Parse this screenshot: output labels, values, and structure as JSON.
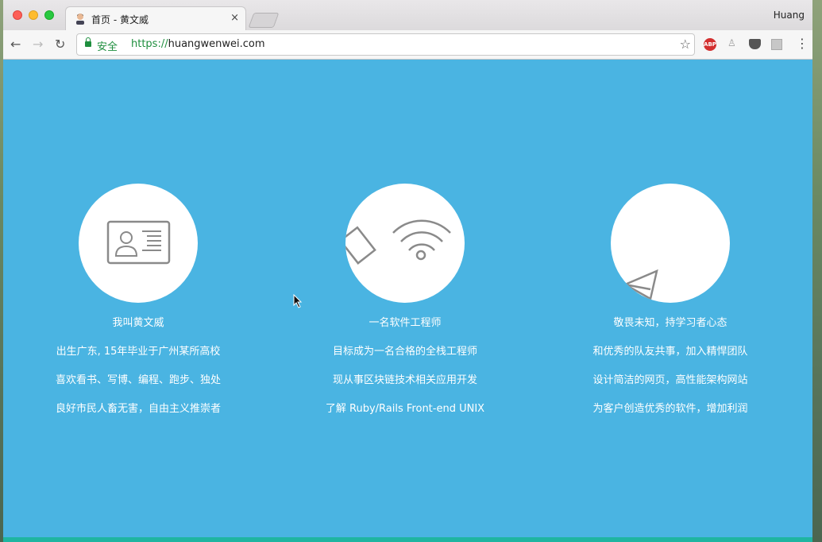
{
  "browser": {
    "tab_title": "首页 - 黄文威",
    "tab_close": "×",
    "profile_name": "Huang",
    "security_label": "安全",
    "url_scheme": "https://",
    "url_host": "huangwenwei.com",
    "extensions": [
      "ABP"
    ],
    "nav": {
      "back": "←",
      "forward": "→",
      "reload": "↻",
      "bookmark": "☆",
      "menu": "⋮"
    }
  },
  "features": [
    {
      "icon": "id-card-icon",
      "title": "我叫黄文威",
      "lines": [
        "出生广东, 15年毕业于广州某所高校",
        "喜欢看书、写博、编程、跑步、独处",
        "良好市民人畜无害，自由主义推崇者"
      ]
    },
    {
      "icon": "wifi-icon",
      "title": "一名软件工程师",
      "lines": [
        "目标成为一名合格的全栈工程师",
        "现从事区块链技术相关应用开发",
        "了解 Ruby/Rails Front-end UNIX"
      ]
    },
    {
      "icon": "paper-plane-icon",
      "title": "敬畏未知，持学习者心态",
      "lines": [
        "和优秀的队友共事，加入精悍团队",
        "设计简洁的网页，高性能架构网站",
        "为客户创造优秀的软件，增加利润"
      ]
    }
  ],
  "colors": {
    "page_background": "#4ab4e2",
    "footer_accent": "#1fb5a1",
    "icon_stroke": "#8a8a8a"
  }
}
